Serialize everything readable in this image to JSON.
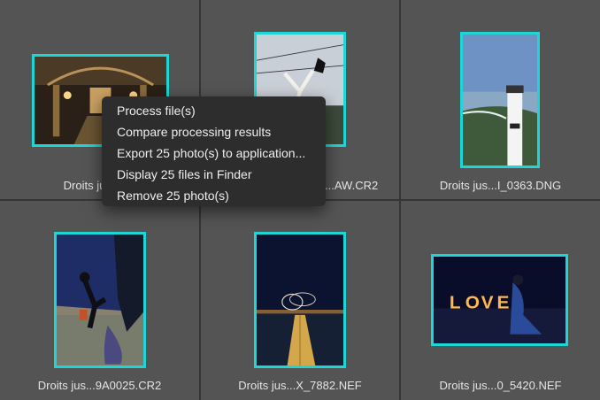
{
  "grid": {
    "cells": [
      {
        "caption": "Droits jusq...C",
        "subject": "ornate opera hall interior"
      },
      {
        "caption": "...AW.CR2",
        "subject": "dancer leaping under wires"
      },
      {
        "caption": "Droits jus...I_0363.DNG",
        "subject": "lighthouse above coastal bay"
      },
      {
        "caption": "Droits jus...9A0025.CR2",
        "subject": "dancers on tiled floor at night"
      },
      {
        "caption": "Droits jus...X_7882.NEF",
        "subject": "pier under night sky with light painting"
      },
      {
        "caption": "Droits jus...0_5420.NEF",
        "subject": "couple with illuminated letters"
      }
    ],
    "selection_color": "#1fd6d6"
  },
  "context_menu": {
    "items": [
      {
        "label": "Process file(s)"
      },
      {
        "label": "Compare processing results"
      },
      {
        "label": "Export 25 photo(s) to application..."
      },
      {
        "label": "Display 25 files in Finder"
      },
      {
        "label": "Remove 25 photo(s)"
      }
    ]
  }
}
